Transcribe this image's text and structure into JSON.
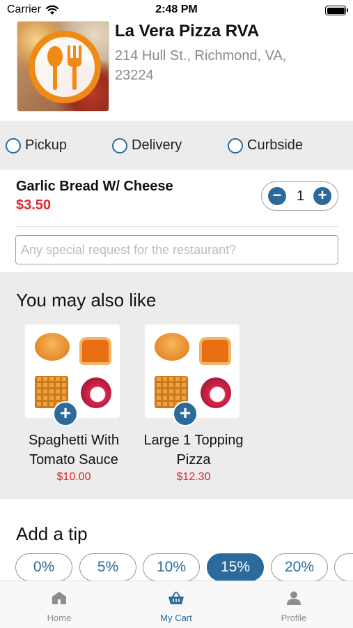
{
  "status_bar": {
    "carrier": "Carrier",
    "time": "2:48 PM"
  },
  "restaurant": {
    "name": "La Vera Pizza RVA",
    "address": "214 Hull St., Richmond, VA, 23224"
  },
  "order_types": [
    {
      "label": "Pickup",
      "selected": false
    },
    {
      "label": "Delivery",
      "selected": false
    },
    {
      "label": "Curbside",
      "selected": false
    }
  ],
  "cart_item": {
    "name": "Garlic Bread W/ Cheese",
    "price": "$3.50",
    "quantity": "1",
    "request_placeholder": "Any special request for the restaurant?",
    "request_value": ""
  },
  "suggestions": {
    "title": "You may also like",
    "items": [
      {
        "name": "Spaghetti With Tomato Sauce",
        "price": "$10.00"
      },
      {
        "name": "Large 1 Topping Pizza",
        "price": "$12.30"
      }
    ]
  },
  "tip": {
    "title": "Add a tip",
    "options": [
      "0%",
      "5%",
      "10%",
      "15%",
      "20%",
      ""
    ],
    "selected": "15%"
  },
  "tab_bar": {
    "tabs": [
      {
        "label": "Home",
        "icon": "home-icon",
        "active": false
      },
      {
        "label": "My Cart",
        "icon": "basket-icon",
        "active": true
      },
      {
        "label": "Profile",
        "icon": "person-icon",
        "active": false
      }
    ]
  },
  "colors": {
    "accent": "#2b6a9a",
    "price": "#e0262f",
    "logo_orange": "#f08a17",
    "section_bg": "#ececec"
  }
}
